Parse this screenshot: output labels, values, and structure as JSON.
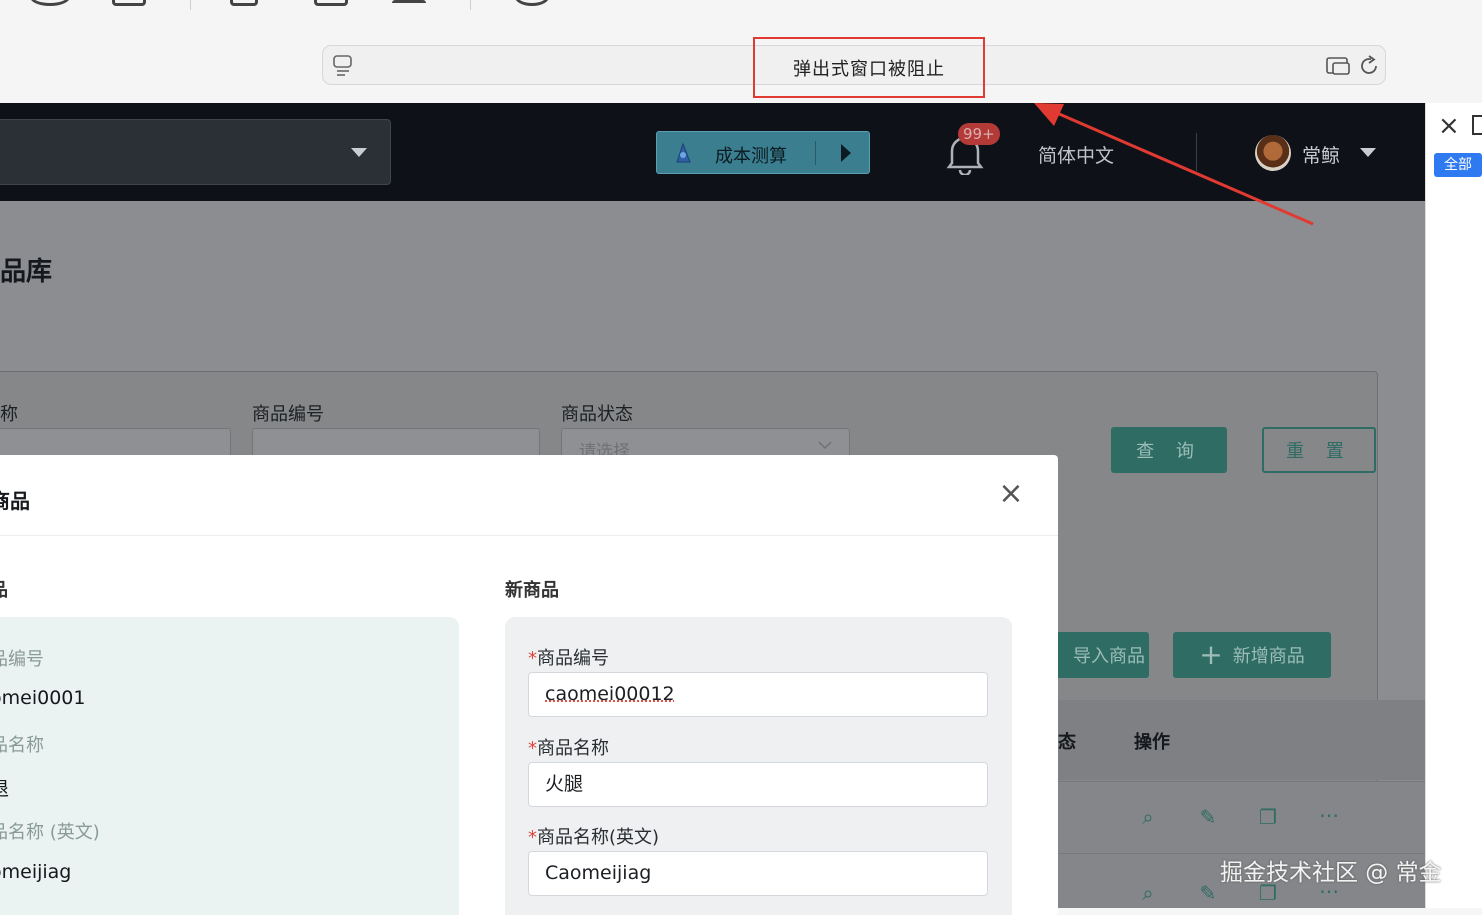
{
  "browser": {
    "popup_blocked_text": "弹出式窗口被阻止"
  },
  "topnav": {
    "cost_button_label": "成本测算",
    "notification_badge": "99+",
    "language": "简体中文",
    "user_name": "常鲸"
  },
  "page": {
    "title_fragment": "品库"
  },
  "filters": {
    "name_label_fragment": "称",
    "code_label": "商品编号",
    "status_label": "商品状态",
    "status_placeholder_fragment": "请选择",
    "query_button": "查 询",
    "reset_button": "重 置"
  },
  "toolbar": {
    "import_button_fragment": "导入商品",
    "add_button": "新增商品"
  },
  "table": {
    "status_header_fragment": "态",
    "actions_header": "操作"
  },
  "modal": {
    "title_fragment": "商品",
    "old_section_title_fragment": "品",
    "new_section_title": "新商品",
    "old_fields": [
      {
        "label": "品编号",
        "value": "omei0001"
      },
      {
        "label": "品名称",
        "value": "退"
      },
      {
        "label": "品名称 (英文)",
        "value": "omeijiag"
      }
    ],
    "new_fields": [
      {
        "label": "商品编号",
        "value": "caomei00012"
      },
      {
        "label": "商品名称",
        "value": "火腿"
      },
      {
        "label": "商品名称(英文)",
        "value": "Caomeijiag"
      }
    ]
  },
  "sidebar": {
    "tag_all": "全部"
  },
  "watermark": "掘金技术社区 @ 常金",
  "colors": {
    "annotation_red": "#e03a32",
    "primary_teal": "#2e6c64",
    "nav_dark": "#0e1218",
    "sidebar_blue": "#2f7af0"
  }
}
